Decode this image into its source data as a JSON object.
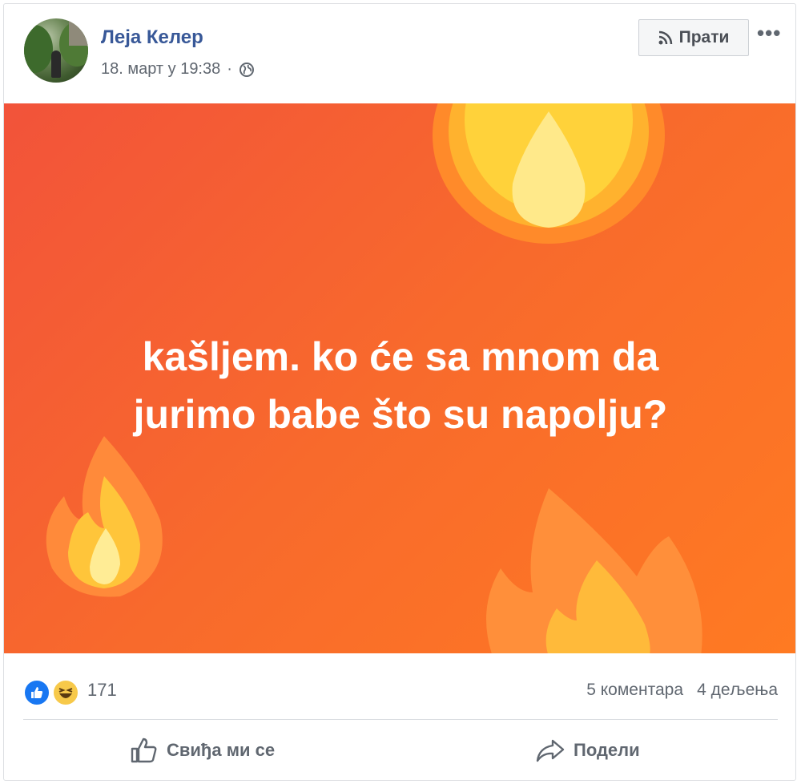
{
  "post": {
    "author": "Леја Келер",
    "date": "18. март у 19:38",
    "separator": "·",
    "follow_label": "Прати",
    "more_label": "•••",
    "text_line1": "kašljem. ko će sa mnom da",
    "text_line2": "jurimo babe što su napolju?",
    "background_color": "#f86a2c",
    "reaction_icons": [
      "like-icon",
      "haha-icon"
    ],
    "reaction_count": "171",
    "comments": "5 коментара",
    "shares": "4 дељења",
    "like_label": "Свиђа ми се",
    "share_label": "Подели"
  }
}
